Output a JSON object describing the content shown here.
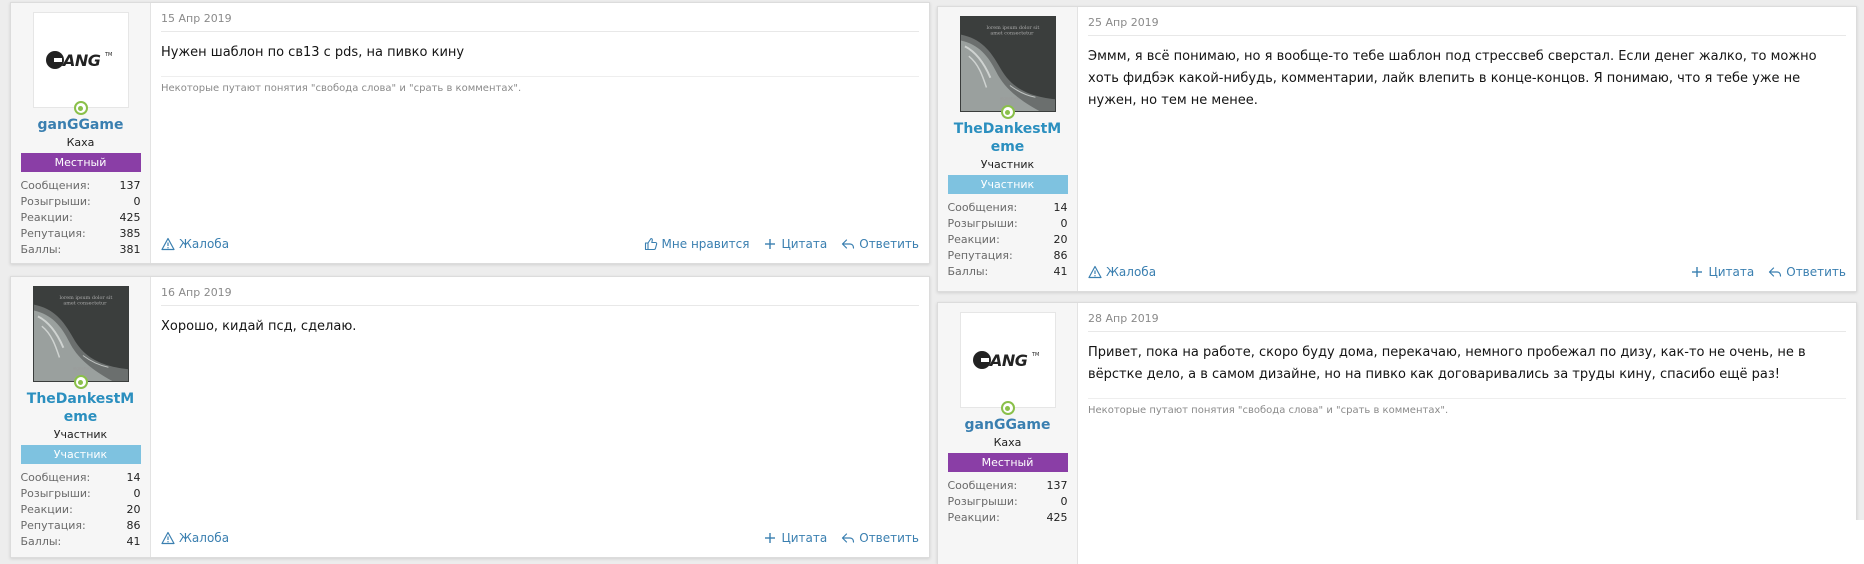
{
  "posts": [
    {
      "date": "15 Апр 2019",
      "text": "Нужен шаблон по св13 с pds, на пивко кину",
      "signature": "Некоторые путают понятия \"свобода слова\" и \"срать в комментах\".",
      "user": {
        "name": "ganGGame",
        "title": "Каха",
        "banner": "Местный",
        "stats": [
          {
            "label": "Сообщения:",
            "value": "137"
          },
          {
            "label": "Розыгрыши:",
            "value": "0"
          },
          {
            "label": "Реакции:",
            "value": "425"
          },
          {
            "label": "Репутация:",
            "value": "385"
          },
          {
            "label": "Баллы:",
            "value": "381"
          }
        ]
      },
      "actions": {
        "report": "Жалоба",
        "like": "Мне нравится",
        "quote": "Цитата",
        "reply": "Ответить"
      }
    },
    {
      "date": "16 Апр 2019",
      "text": "Хорошо, кидай псд, сделаю.",
      "user": {
        "name": "TheDankestMeme",
        "title": "Участник",
        "banner": "Участник",
        "stats": [
          {
            "label": "Сообщения:",
            "value": "14"
          },
          {
            "label": "Розыгрыши:",
            "value": "0"
          },
          {
            "label": "Реакции:",
            "value": "20"
          },
          {
            "label": "Репутация:",
            "value": "86"
          },
          {
            "label": "Баллы:",
            "value": "41"
          }
        ]
      },
      "actions": {
        "report": "Жалоба",
        "quote": "Цитата",
        "reply": "Ответить"
      }
    },
    {
      "date": "25 Апр 2019",
      "text": "Эммм, я всё понимаю, но я вообще-то тебе шаблон под стрессвеб сверстал. Если денег жалко, то можно хоть фидбэк какой-нибудь, комментарии, лайк влепить в конце-концов. Я понимаю, что я тебе уже не нужен, но тем не менее.",
      "user": {
        "name": "TheDankestMeme",
        "title": "Участник",
        "banner": "Участник",
        "stats": [
          {
            "label": "Сообщения:",
            "value": "14"
          },
          {
            "label": "Розыгрыши:",
            "value": "0"
          },
          {
            "label": "Реакции:",
            "value": "20"
          },
          {
            "label": "Репутация:",
            "value": "86"
          },
          {
            "label": "Баллы:",
            "value": "41"
          }
        ]
      },
      "actions": {
        "report": "Жалоба",
        "quote": "Цитата",
        "reply": "Ответить"
      }
    },
    {
      "date": "28 Апр 2019",
      "text": "Привет, пока на работе, скоро буду дома, перекачаю, немного пробежал по дизу, как-то не очень, не в вёрстке дело, а в самом дизайне, но на пивко как договаривались за труды кину, спасибо ещё раз!",
      "signature": "Некоторые путают понятия \"свобода слова\" и \"срать в комментах\".",
      "user": {
        "name": "ganGGame",
        "title": "Каха",
        "banner": "Местный",
        "stats": [
          {
            "label": "Сообщения:",
            "value": "137"
          },
          {
            "label": "Розыгрыши:",
            "value": "0"
          },
          {
            "label": "Реакции:",
            "value": "425"
          }
        ]
      }
    }
  ],
  "colors": {
    "local_banner": "#8a3ea6",
    "member_banner": "#7ec2e0",
    "link": "#3a7fb0",
    "online": "#8ac04a"
  },
  "icons": {
    "gang_logo": "gang-logo-icon",
    "dark_avatar": "wave-avatar-icon"
  }
}
